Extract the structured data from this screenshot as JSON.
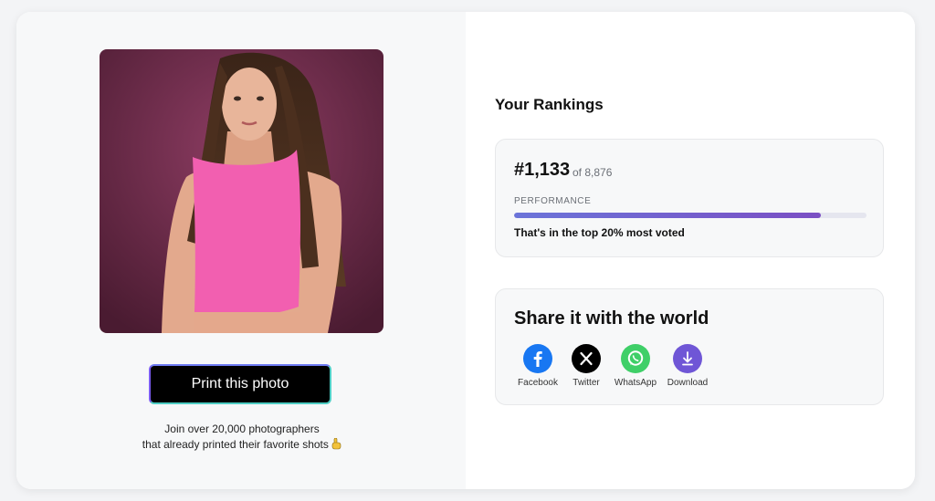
{
  "left": {
    "print_button_label": "Print this photo",
    "join_line1": "Join over 20,000 photographers",
    "join_line2": "that already printed their favorite shots",
    "join_emoji": "pointing-hand-icon"
  },
  "rankings": {
    "title": "Your Rankings",
    "rank": "#1,133",
    "of_total": "of 8,876",
    "performance_label": "PERFORMANCE",
    "performance_fraction": 0.87,
    "summary": "That's in the top 20% most voted",
    "bar_colors": [
      "#6b74d9",
      "#7b4fc4"
    ]
  },
  "share": {
    "title": "Share it with the world",
    "items": [
      {
        "label": "Facebook",
        "icon": "facebook-icon",
        "color": "#1877f2"
      },
      {
        "label": "Twitter",
        "icon": "x-icon",
        "color": "#000000"
      },
      {
        "label": "WhatsApp",
        "icon": "whatsapp-icon",
        "color": "#3fcf68"
      },
      {
        "label": "Download",
        "icon": "download-icon",
        "color": "#6f56d6"
      }
    ]
  }
}
